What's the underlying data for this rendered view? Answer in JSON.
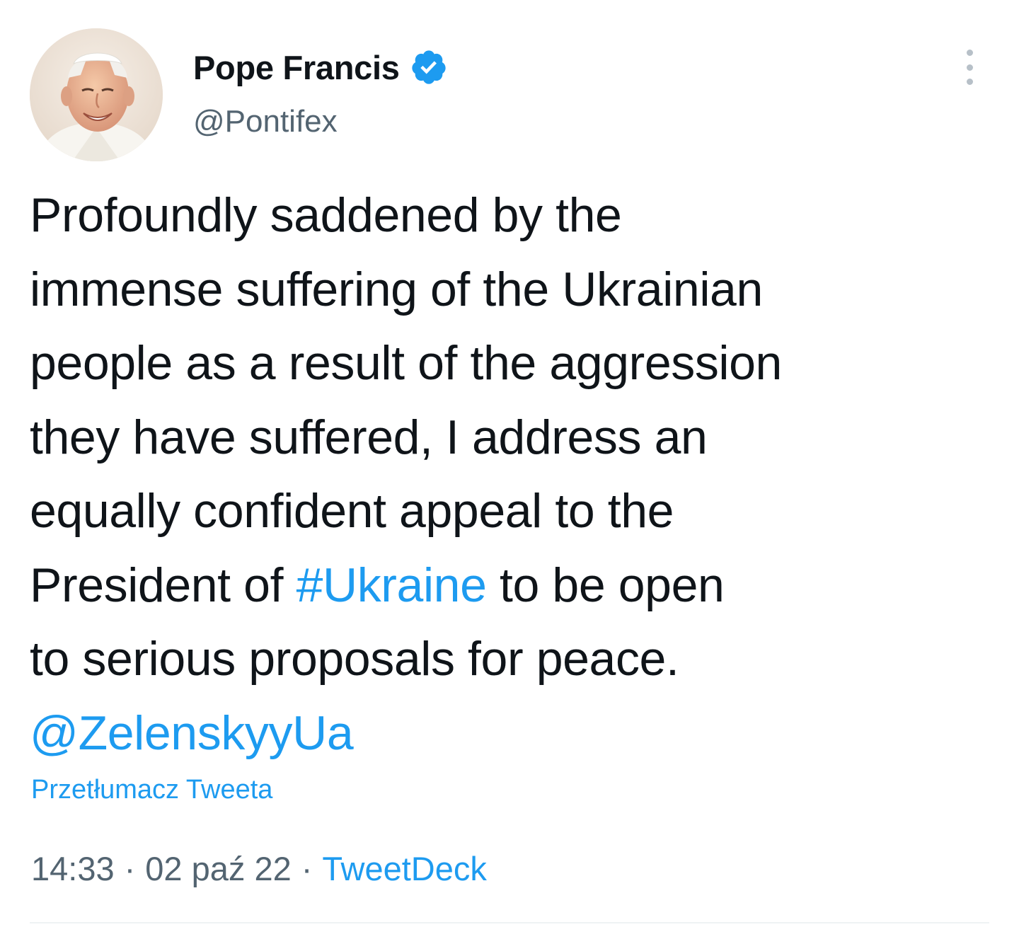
{
  "author": {
    "display_name": "Pope Francis",
    "handle": "@Pontifex",
    "verified": true,
    "verified_icon": "verified-badge-icon",
    "avatar_icon": "avatar-photo"
  },
  "tweet": {
    "lines": [
      {
        "parts": [
          {
            "text": "Profoundly saddened by the",
            "link": false
          }
        ]
      },
      {
        "parts": [
          {
            "text": "immense suffering of the Ukrainian",
            "link": false
          }
        ]
      },
      {
        "parts": [
          {
            "text": "people as a result of the aggression",
            "link": false
          }
        ]
      },
      {
        "parts": [
          {
            "text": "they have suffered, I address an",
            "link": false
          }
        ]
      },
      {
        "parts": [
          {
            "text": "equally confident appeal to the",
            "link": false
          }
        ]
      },
      {
        "parts": [
          {
            "text": "President of ",
            "link": false
          },
          {
            "text": "#Ukraine",
            "link": true
          },
          {
            "text": " to be open",
            "link": false
          }
        ]
      },
      {
        "parts": [
          {
            "text": "to serious proposals for peace.",
            "link": false
          }
        ]
      },
      {
        "parts": [
          {
            "text": "@ZelenskyyUa",
            "link": true
          }
        ]
      }
    ]
  },
  "translate_label": "Przetłumacz Tweeta",
  "meta": {
    "time": "14:33",
    "separator": "·",
    "date": "02 paź 22",
    "source": "TweetDeck"
  },
  "menu": {
    "icon": "more-options-icon"
  },
  "colors": {
    "text": "#0f1419",
    "secondary": "#536471",
    "link": "#1d9bf0",
    "divider": "#eff3f4"
  }
}
